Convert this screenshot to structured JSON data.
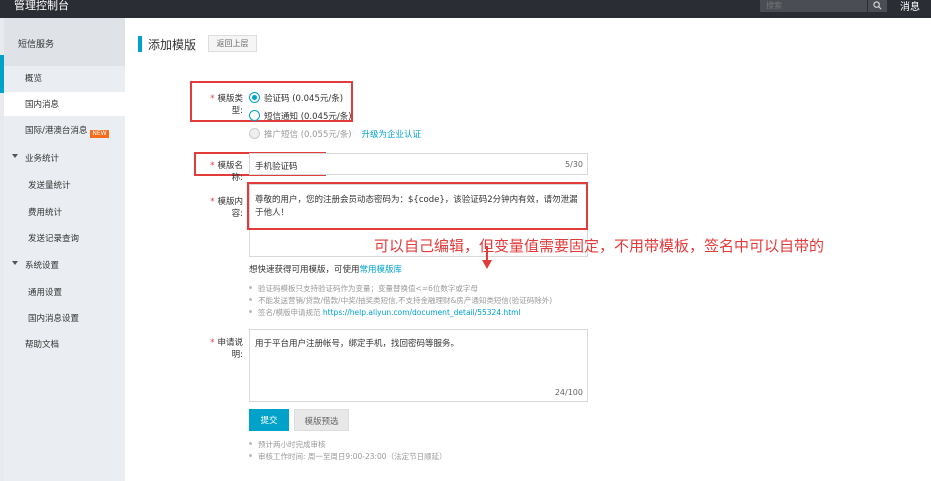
{
  "topbar": {
    "brand": "管理控制台",
    "search_placeholder": "搜索",
    "messages": "消息"
  },
  "sidebar": {
    "section_title": "短信服务",
    "items": [
      {
        "label": "概览"
      },
      {
        "label": "国内消息"
      },
      {
        "label": "国际/港澳台消息",
        "badge": "NEW"
      },
      {
        "label": "业务统计"
      },
      {
        "label": "发送量统计"
      },
      {
        "label": "费用统计"
      },
      {
        "label": "发送记录查询"
      },
      {
        "label": "系统设置"
      },
      {
        "label": "通用设置"
      },
      {
        "label": "国内消息设置"
      },
      {
        "label": "帮助文档"
      }
    ]
  },
  "page": {
    "title": "添加模版",
    "back_label": "返回上层"
  },
  "form": {
    "type_label": "模版类型:",
    "type_options": [
      {
        "label": "验证码 (0.045元/条)"
      },
      {
        "label": "短信通知 (0.045元/条)"
      },
      {
        "label": "推广短信 (0.055元/条)"
      }
    ],
    "upgrade_link": "升级为企业认证",
    "name_label": "模版名称:",
    "name_value": "手机验证码",
    "name_count": "5/30",
    "content_label": "模版内容:",
    "content_value": "尊敬的用户，您的注册会员动态密码为：${code}，请勿泄漏于他人！",
    "content_value_display": "尊敬的用户，您的注册会员动态密码为：${code}，该验证码2分钟内有效，请勿泄漏于他人！",
    "hint_prefix": "想快速获得可用模版，可使用",
    "hint_link": "常用模版库",
    "tips": [
      "验证码模板只支持验证码作为变量；变量替换值<=6位数字或字母",
      "不能发送营销/贷款/借款/中奖/抽奖类短信,不支持金融理财&房产通知类短信(验证码除外)",
      "签名/模版申请规范"
    ],
    "tips_url": "https://help.aliyun.com/document_detail/55324.html",
    "desc_label": "申请说明:",
    "desc_value": "用于平台用户注册帐号，绑定手机，找回密码等服务。",
    "desc_count": "24/100",
    "submit_label": "提交",
    "preview_label": "模版预选",
    "footer_tips": [
      "预计两小时完成审核",
      "审核工作时间: 周一至周日9:00-23:00（法定节日顺延）"
    ]
  },
  "annotation": {
    "text": "可以自己编辑，但变量值需要固定，不用带模板，签名中可以自带的"
  },
  "colors": {
    "accent": "#00a2ca",
    "annotation_red": "#e23b3b",
    "topbar": "#2a2d33",
    "sidebar": "#eaedf1"
  }
}
